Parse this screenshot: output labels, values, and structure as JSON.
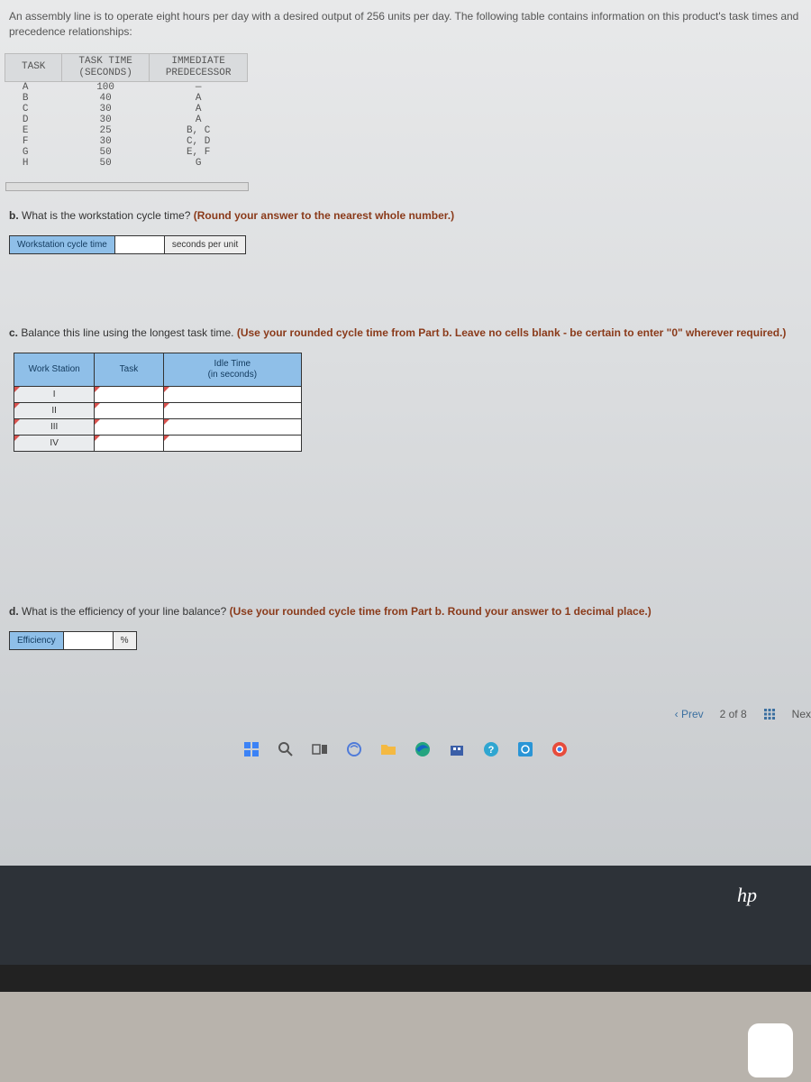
{
  "intro": "An assembly line is to operate eight hours per day with a desired output of 256 units per day. The following table contains information on this product's task times and precedence relationships:",
  "task_table": {
    "headers": [
      "TASK",
      "TASK TIME\n(SECONDS)",
      "IMMEDIATE\nPREDECESSOR"
    ],
    "rows": [
      {
        "task": "A",
        "time": "100",
        "pred": "—"
      },
      {
        "task": "B",
        "time": "40",
        "pred": "A"
      },
      {
        "task": "C",
        "time": "30",
        "pred": "A"
      },
      {
        "task": "D",
        "time": "30",
        "pred": "A"
      },
      {
        "task": "E",
        "time": "25",
        "pred": "B, C"
      },
      {
        "task": "F",
        "time": "30",
        "pred": "C, D"
      },
      {
        "task": "G",
        "time": "50",
        "pred": "E, F"
      },
      {
        "task": "H",
        "time": "50",
        "pred": "G"
      }
    ]
  },
  "part_b": {
    "label": "b.",
    "question": "What is the workstation cycle time?",
    "hint": "(Round your answer to the nearest whole number.)",
    "field_label": "Workstation cycle time",
    "unit": "seconds per unit"
  },
  "part_c": {
    "label": "c.",
    "question": "Balance this line using the longest task time.",
    "hint": "(Use your rounded cycle time from Part b. Leave no cells blank - be certain to enter \"0\" wherever required.)",
    "headers": [
      "Work Station",
      "Task",
      "Idle Time\n(in seconds)"
    ],
    "rows": [
      "I",
      "II",
      "III",
      "IV"
    ]
  },
  "part_d": {
    "label": "d.",
    "question": "What is the efficiency of your line balance?",
    "hint": "(Use your rounded cycle time from Part b. Round your answer to 1 decimal place.)",
    "field_label": "Efficiency",
    "unit": "%"
  },
  "nav": {
    "prev": "Prev",
    "count": "2 of 8",
    "next": "Nex"
  },
  "hp": "hp"
}
